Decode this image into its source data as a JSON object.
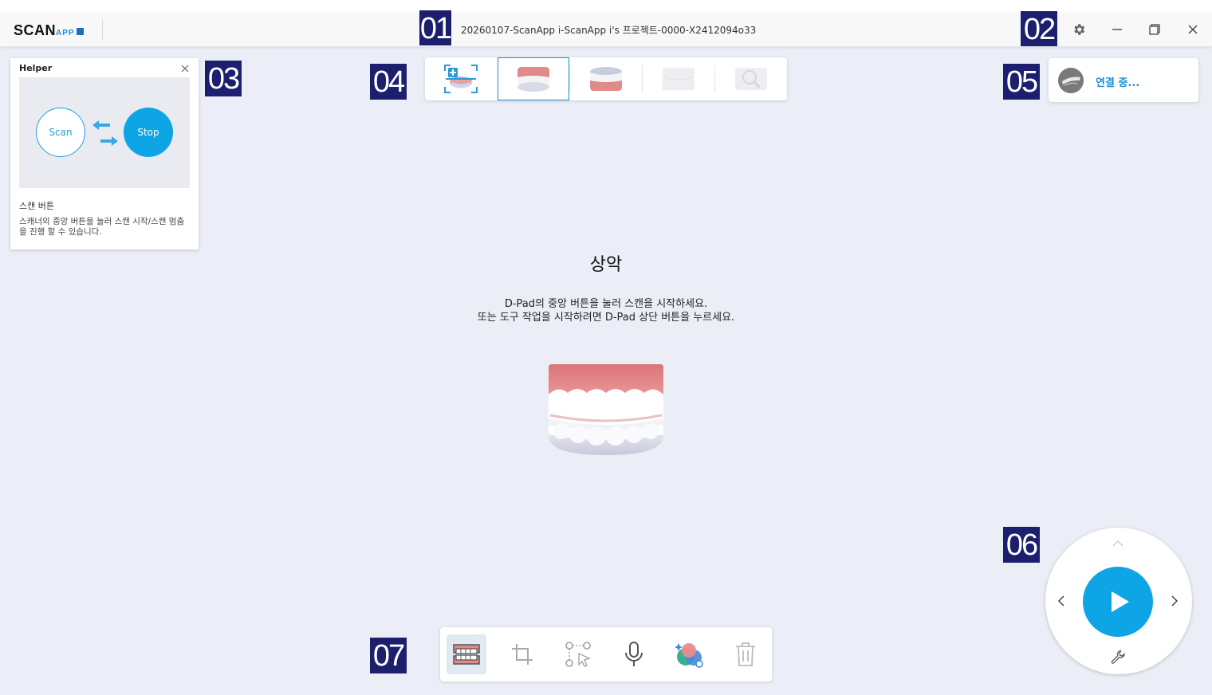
{
  "app": {
    "logo_main": "SCAN",
    "logo_sub": "APP",
    "document_title": "20260107-ScanApp i-ScanApp i's 프로젝트-0000-X2412094o33"
  },
  "markers": [
    "01",
    "02",
    "03",
    "04",
    "05",
    "06",
    "07"
  ],
  "helper": {
    "title": "Helper",
    "scan_label": "Scan",
    "stop_label": "Stop",
    "heading": "스캔 버튼",
    "description": "스캐너의 중앙 버튼을 눌러 스캔 시작/스캔 멈춤을 진행 할 수 있습니다."
  },
  "stages": {
    "items": [
      "scan-setup",
      "upper-jaw",
      "lower-jaw",
      "bite",
      "review"
    ],
    "selected": "upper-jaw"
  },
  "connection": {
    "status": "연결 중..."
  },
  "main": {
    "jaw_title": "상악",
    "instruction_line1": "D-Pad의 중앙 버튼을 눌러 스캔을 시작하세요.",
    "instruction_line2": "또는 도구 작업을 시작하려면 D-Pad 상단 버튼을 누르세요."
  },
  "tools": [
    "jaw-tool",
    "crop-tool",
    "select-tool",
    "microphone",
    "color-tool",
    "delete-tool"
  ],
  "colors": {
    "accent": "#0ea5e6",
    "marker": "#1b1f6e",
    "gum": "#e08a8a",
    "connecting_text": "#1a8fd8"
  }
}
